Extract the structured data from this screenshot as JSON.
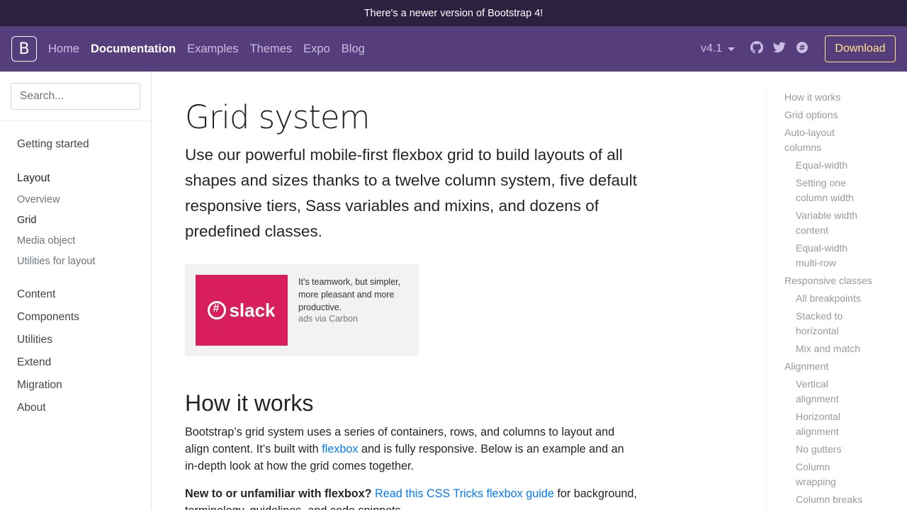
{
  "announcement": "There's a newer version of Bootstrap 4!",
  "navbar": {
    "brand": "B",
    "links": [
      "Home",
      "Documentation",
      "Examples",
      "Themes",
      "Expo",
      "Blog"
    ],
    "version": "v4.1",
    "download": "Download",
    "icons": [
      "github-icon",
      "twitter-icon",
      "slack-icon"
    ]
  },
  "sidebar": {
    "search_placeholder": "Search...",
    "getting_started": "Getting started",
    "layout": "Layout",
    "layout_items": [
      "Overview",
      "Grid",
      "Media object",
      "Utilities for layout"
    ],
    "sections": [
      "Content",
      "Components",
      "Utilities",
      "Extend",
      "Migration",
      "About"
    ]
  },
  "main": {
    "title": "Grid system",
    "lead": "Use our powerful mobile-first flexbox grid to build layouts of all shapes and sizes thanks to a twelve column system, five default responsive tiers, Sass variables and mixins, and dozens of predefined classes.",
    "ad": {
      "logo_text": "slack",
      "text": "It's teamwork, but simpler, more pleasant and more productive.",
      "via": "ads via Carbon"
    },
    "h2": "How it works",
    "p1_a": "Bootstrap’s grid system uses a series of containers, rows, and columns to layout and align content. It’s built with ",
    "p1_link": "flexbox",
    "p1_b": " and is fully responsive. Below is an example and an in-depth look at how the grid comes together.",
    "p2_strong": "New to or unfamiliar with flexbox?",
    "p2_link": "Read this CSS Tricks flexbox guide",
    "p2_rest": " for background, terminology, guidelines, and code snippets."
  },
  "toc": {
    "items": [
      {
        "label": "How it works",
        "level": 1
      },
      {
        "label": "Grid options",
        "level": 1
      },
      {
        "label": "Auto-layout columns",
        "level": 1
      },
      {
        "label": "Equal-width",
        "level": 2
      },
      {
        "label": "Setting one column width",
        "level": 2
      },
      {
        "label": "Variable width content",
        "level": 2
      },
      {
        "label": "Equal-width multi-row",
        "level": 2
      },
      {
        "label": "Responsive classes",
        "level": 1
      },
      {
        "label": "All breakpoints",
        "level": 2
      },
      {
        "label": "Stacked to horizontal",
        "level": 2
      },
      {
        "label": "Mix and match",
        "level": 2
      },
      {
        "label": "Alignment",
        "level": 1
      },
      {
        "label": "Vertical alignment",
        "level": 2
      },
      {
        "label": "Horizontal alignment",
        "level": 2
      },
      {
        "label": "No gutters",
        "level": 2
      },
      {
        "label": "Column wrapping",
        "level": 2
      },
      {
        "label": "Column breaks",
        "level": 2
      }
    ]
  },
  "colors": {
    "navbar": "#563d7c",
    "announcement": "#2b2141",
    "download_accent": "#ffe484",
    "link": "#007bff",
    "slack": "#d81e5b"
  }
}
